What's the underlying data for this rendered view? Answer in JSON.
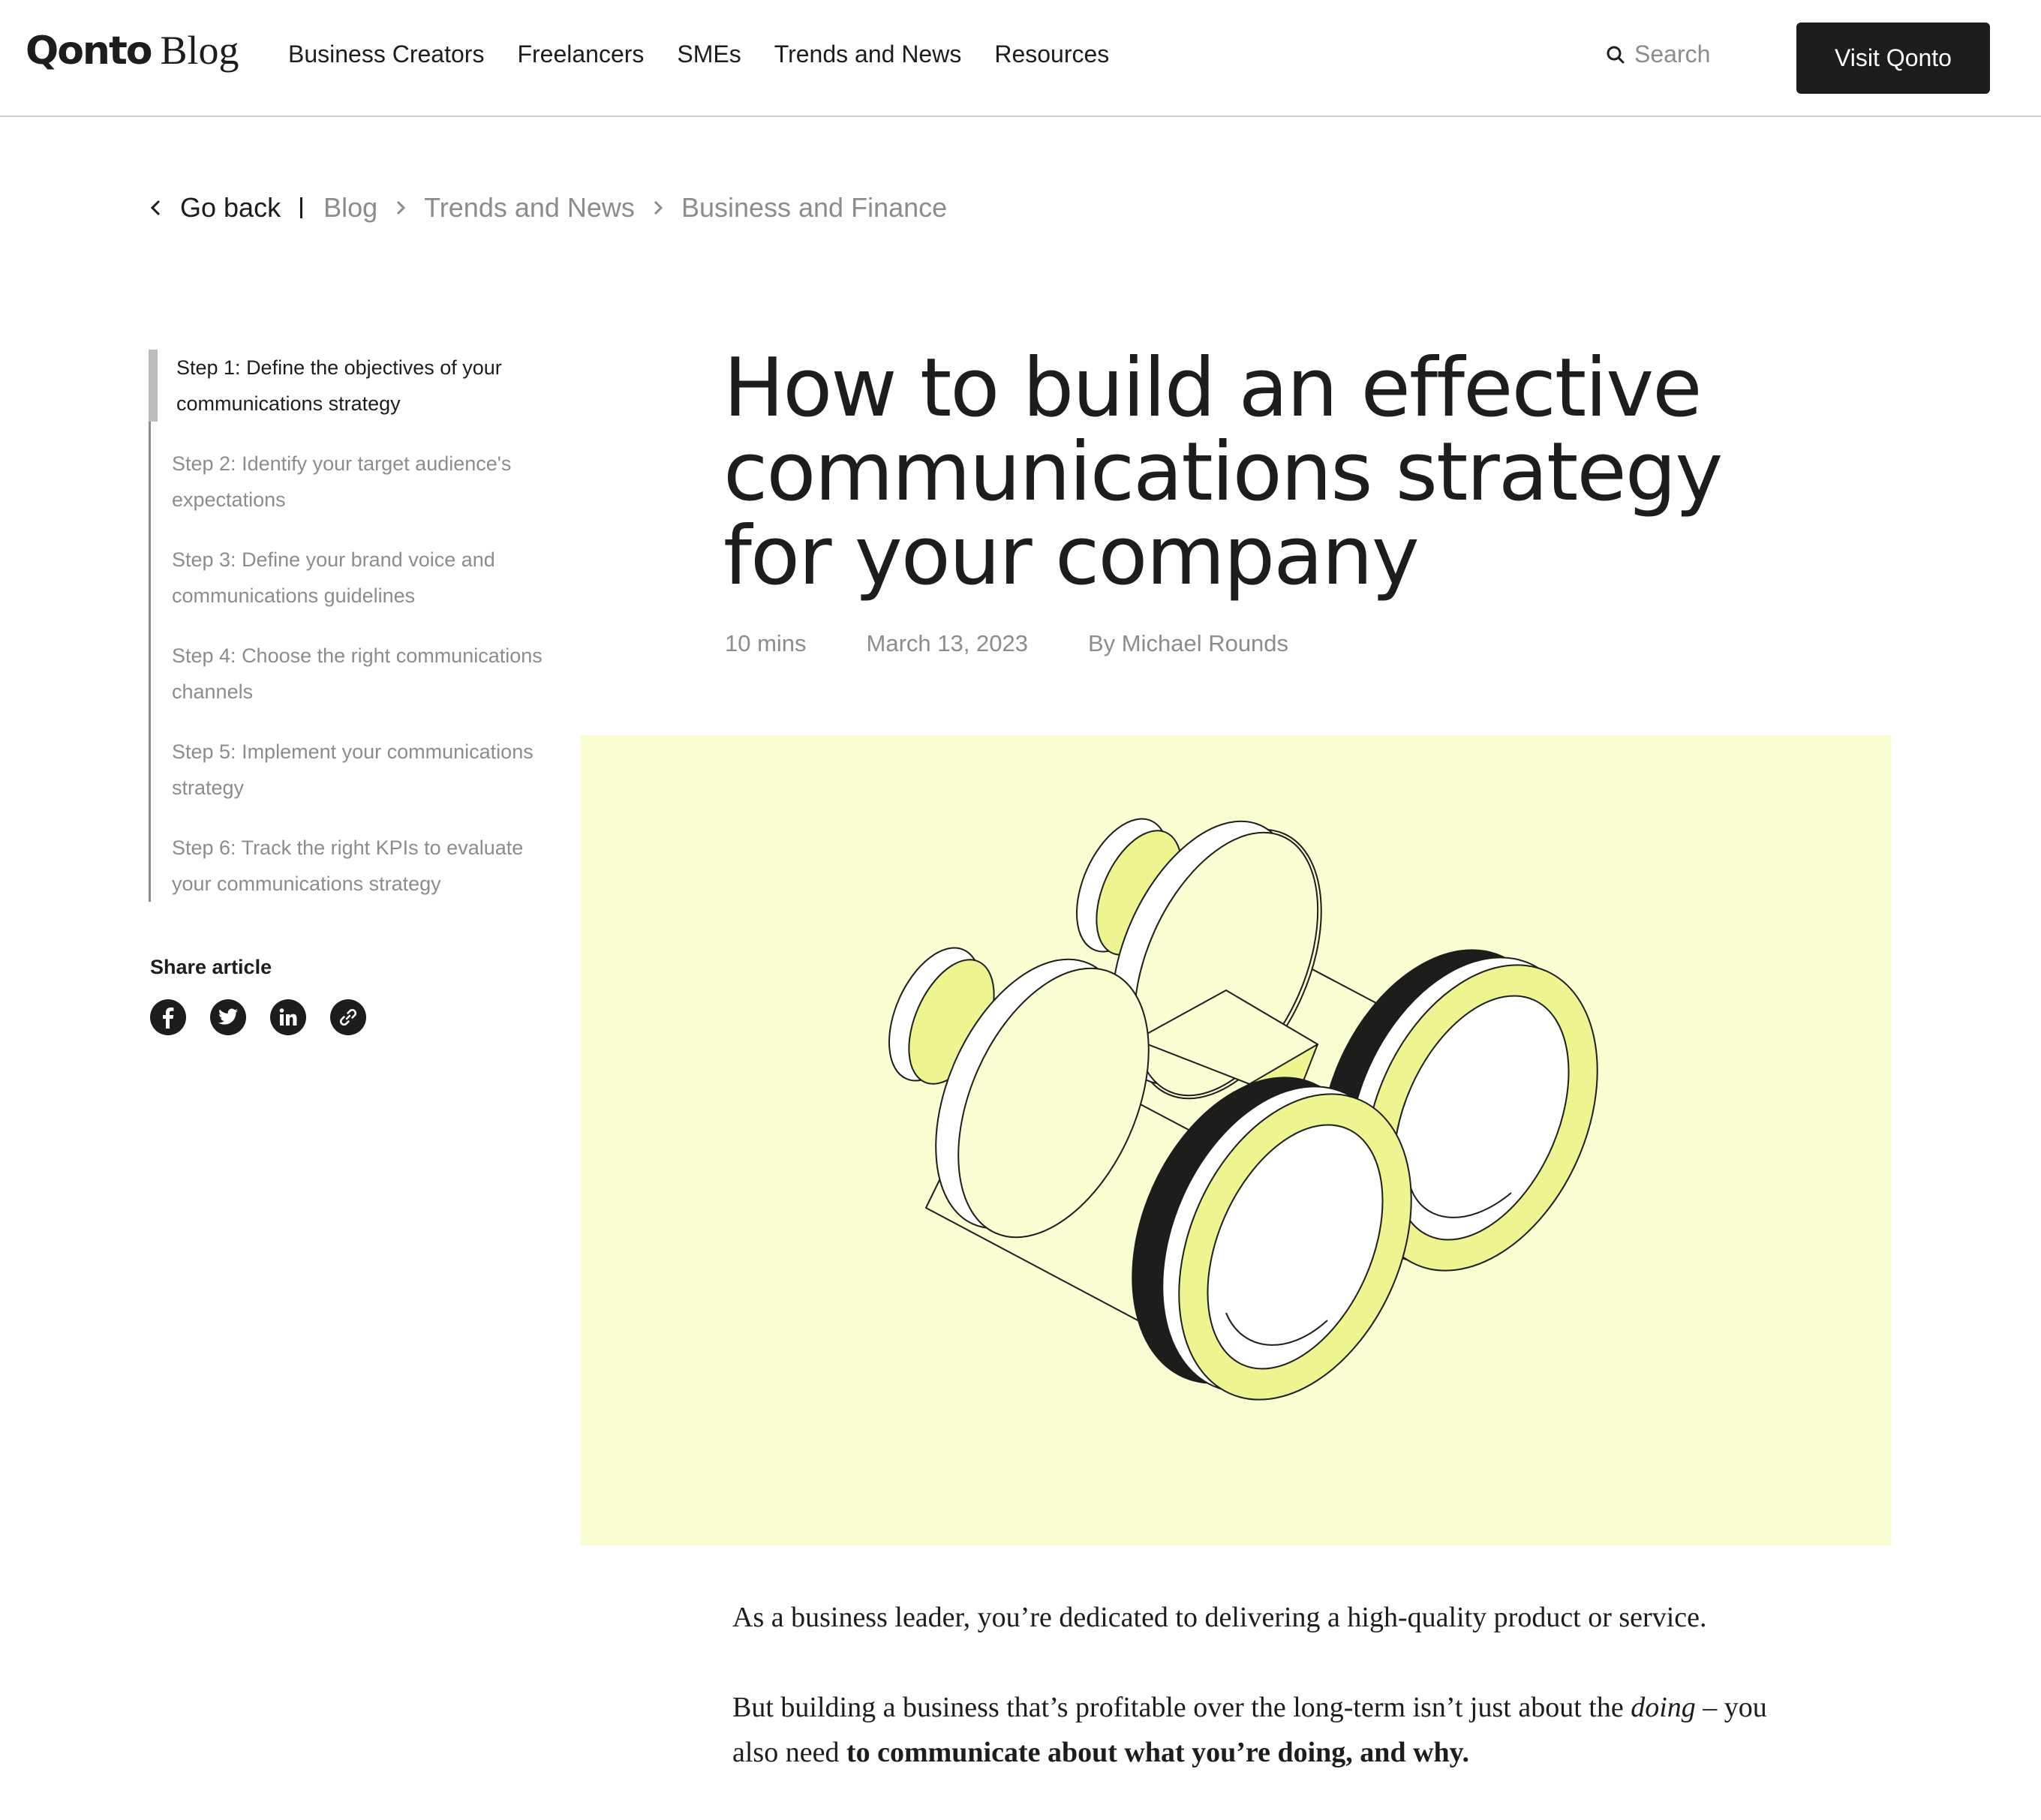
{
  "header": {
    "logo_mark": "Qonto",
    "logo_blog": "Blog",
    "nav": [
      "Business Creators",
      "Freelancers",
      "SMEs",
      "Trends and News",
      "Resources"
    ],
    "search_placeholder": "Search",
    "cta_label": "Visit Qonto"
  },
  "breadcrumb": {
    "back_label": "Go back",
    "items": [
      "Blog",
      "Trends and News",
      "Business and Finance"
    ]
  },
  "toc": {
    "items": [
      "Step 1: Define the objectives of your communications strategy",
      "Step 2: Identify your target audience's expectations",
      "Step 3: Define your brand voice and communications guidelines",
      "Step 4: Choose the right communications channels",
      "Step 5: Implement your communications strategy",
      "Step 6: Track the right KPIs to evaluate your communications strategy"
    ],
    "active_index": 0
  },
  "share": {
    "title": "Share article",
    "icons": [
      "facebook-icon",
      "twitter-icon",
      "linkedin-icon",
      "link-icon"
    ]
  },
  "article": {
    "title": "How to build an effective communications strategy for your company",
    "read_time": "10 mins",
    "date": "March 13, 2023",
    "author": "By Michael Rounds",
    "hero_image": "binoculars-illustration",
    "paragraph_1": "As a business leader, you’re dedicated to delivering a high-quality product or service.",
    "paragraph_2_start": "But building a business that’s profitable over the long-term isn’t just about the",
    "paragraph_2_em": "doing",
    "paragraph_2_mid": " – you also need ",
    "paragraph_2_strong": "to communicate about what you’re doing, and why."
  },
  "colors": {
    "text": "#1d1d1b",
    "muted": "#8c8c8c",
    "hero_bg": "#fbfdd2",
    "lens_yellow": "#eef590",
    "button_bg": "#1d1d1b"
  }
}
